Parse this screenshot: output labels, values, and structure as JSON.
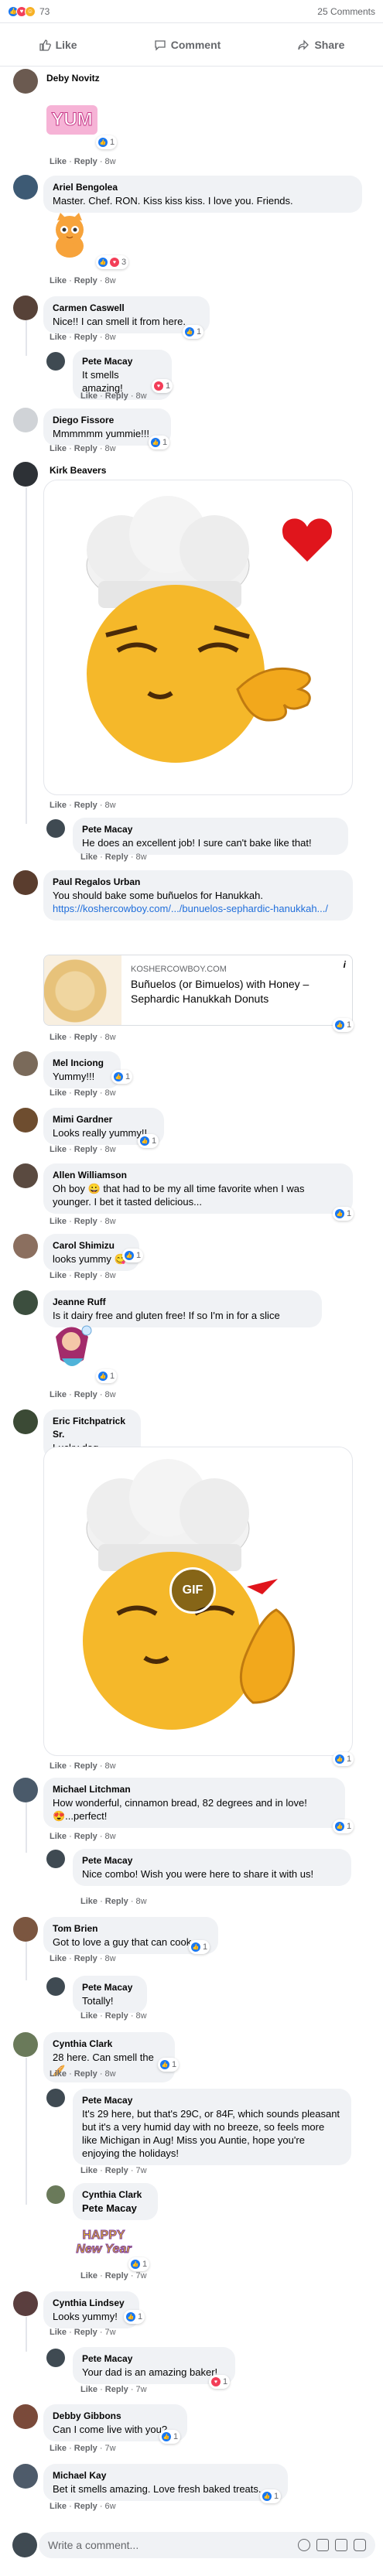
{
  "reactions": {
    "count": "73",
    "comments": "25 Comments"
  },
  "actions": {
    "like": "Like",
    "comment": "Comment",
    "share": "Share"
  },
  "labels": {
    "like": "Like",
    "reply": "Reply",
    "sep": "·"
  },
  "comments": [
    {
      "name": "Deby Novitz",
      "text": "",
      "time": "8w",
      "rx": "1"
    },
    {
      "name": "Ariel Bengolea",
      "text": "Master. Chef. RON. Kiss kiss kiss. I love you. Friends.",
      "time": "8w",
      "rx": "3"
    },
    {
      "name": "Carmen Caswell",
      "text": "Nice!! I can smell it from here.",
      "time": "8w",
      "rx": "1"
    },
    {
      "name": "Pete Macay",
      "text": "It smells amazing!",
      "time": "8w",
      "rx": "1"
    },
    {
      "name": "Diego Fissore",
      "text": "Mmmmmm yummie!!!",
      "time": "8w",
      "rx": "1"
    },
    {
      "name": "Kirk Beavers",
      "text": "",
      "time": "8w",
      "rx": ""
    },
    {
      "name": "Pete Macay",
      "text": "He does an excellent job! I sure can't bake like that!",
      "time": "8w",
      "rx": ""
    },
    {
      "name": "Paul Regalos Urban",
      "text": "You should bake some buñuelos for Hanukkah.",
      "link": "https://koshercowboy.com/.../bunuelos-sephardic-hanukkah.../",
      "time": "8w",
      "rx": "1"
    },
    {
      "name": "Mel Inciong",
      "text": "Yummy!!!",
      "time": "8w",
      "rx": "1"
    },
    {
      "name": "Mimi Gardner",
      "text": "Looks really yummy!!",
      "time": "8w",
      "rx": "1"
    },
    {
      "name": "Allen Williamson",
      "text": "Oh boy 😀 that had to be my all time favorite when I was younger. I bet it tasted delicious...",
      "time": "8w",
      "rx": "1"
    },
    {
      "name": "Carol Shimizu",
      "text": "looks yummy 😋",
      "time": "8w",
      "rx": "1"
    },
    {
      "name": "Jeanne Ruff",
      "text": "Is it dairy free and gluten free! If so I'm in for a slice",
      "time": "8w",
      "rx": "1"
    },
    {
      "name": "Eric Fitchpatrick Sr.",
      "text": "Lucky dog",
      "time": "8w",
      "rx": "1"
    },
    {
      "name": "Michael Litchman",
      "text": "How wonderful, cinnamon bread, 82 degrees and in love!",
      "text2": "😍...perfect!",
      "time": "8w",
      "rx": "1"
    },
    {
      "name": "Pete Macay",
      "text": "Nice combo! Wish you were here to share it with us!",
      "time": "8w",
      "rx": ""
    },
    {
      "name": "Tom Brien",
      "text": "Got to love a guy that can cook",
      "time": "8w",
      "rx": "1"
    },
    {
      "name": "Pete Macay",
      "text": "Totally!",
      "time": "8w",
      "rx": ""
    },
    {
      "name": "Cynthia Clark",
      "text": "28 here. Can smell the 🥖",
      "time": "8w",
      "rx": "1"
    },
    {
      "name": "Pete Macay",
      "text": "It's 29 here, but that's 29C, or 84F, which sounds pleasant but it's a very humid day with no breeze, so feels more like Michigan in Aug! Miss you Auntie, hope you're enjoying the holidays!",
      "time": "7w",
      "rx": ""
    },
    {
      "name": "Cynthia Clark",
      "text": "Pete Macay",
      "time": "7w",
      "rx": "1"
    },
    {
      "name": "Cynthia Lindsey",
      "text": "Looks yummy!",
      "time": "7w",
      "rx": "1"
    },
    {
      "name": "Pete Macay",
      "text": "Your dad is an amazing baker!",
      "time": "7w",
      "rx": "1"
    },
    {
      "name": "Debby Gibbons",
      "text": "Can I come live with you?",
      "time": "7w",
      "rx": "1"
    },
    {
      "name": "Michael Kay",
      "text": "Bet it smells amazing. Love fresh baked treats.",
      "time": "6w",
      "rx": "1"
    }
  ],
  "linkcard": {
    "domain": "KOSHERCOWBOY.COM",
    "title": "Buñuelos (or Bimuelos) with Honey – Sephardic Hanukkah Donuts"
  },
  "stickers": {
    "yum": "YUM",
    "happy": "HAPPY",
    "newyear": "New Year",
    "gif": "GIF"
  },
  "composer": {
    "placeholder": "Write a comment..."
  },
  "colors": {
    "like": "#1877f2",
    "love": "#f33e58",
    "bubble": "#f0f2f5",
    "link": "#216fdb"
  }
}
